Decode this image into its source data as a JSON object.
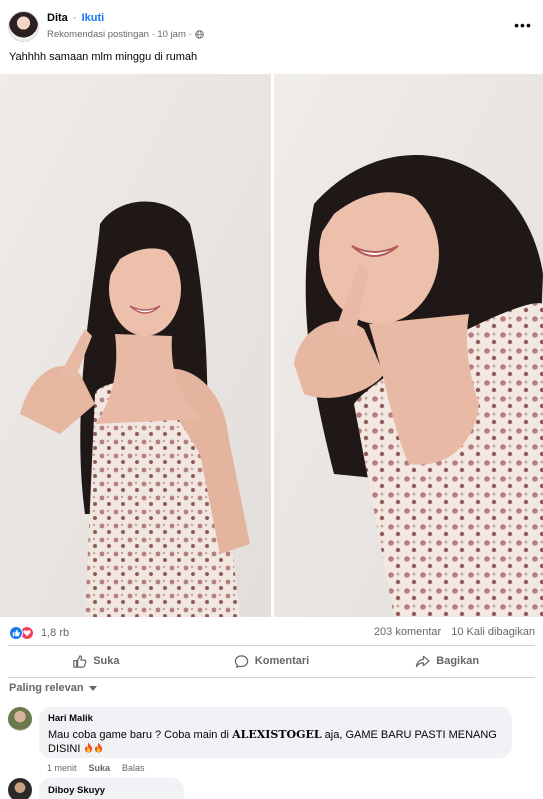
{
  "post": {
    "author": "Dita",
    "separator": "·",
    "follow_label": "Ikuti",
    "meta": "Rekomendasi postingan · 10 jam ·",
    "text": "Yahhhh samaan mlm minggu di rumah"
  },
  "stats": {
    "reaction_count": "1,8 rb",
    "comments": "203 komentar",
    "shares": "10 Kali dibagikan"
  },
  "actions": {
    "like": "Suka",
    "comment": "Komentari",
    "share": "Bagikan"
  },
  "sort": {
    "label": "Paling relevan"
  },
  "comments": [
    {
      "name": "Hari Malik",
      "text_before": "Mau coba game baru ? Coba main di ",
      "brand": "ALEXISTOGEL",
      "text_after": " aja, GAME BARU PASTI MENANG DISINI",
      "time": "1 menit",
      "like": "Suka",
      "reply": "Balas"
    },
    {
      "name": "Diboy Skuyy"
    }
  ],
  "icons": {
    "globe": "globe-icon",
    "more": "more-options-icon",
    "like": "thumbs-up-icon",
    "love": "heart-icon",
    "comment": "speech-bubble-icon",
    "share": "share-arrow-icon",
    "fire": "fire-emoji-icon"
  },
  "colors": {
    "accent": "#1877f2",
    "love": "#f33e58",
    "muted_text": "#65676b",
    "bubble": "#f0f2f5"
  }
}
